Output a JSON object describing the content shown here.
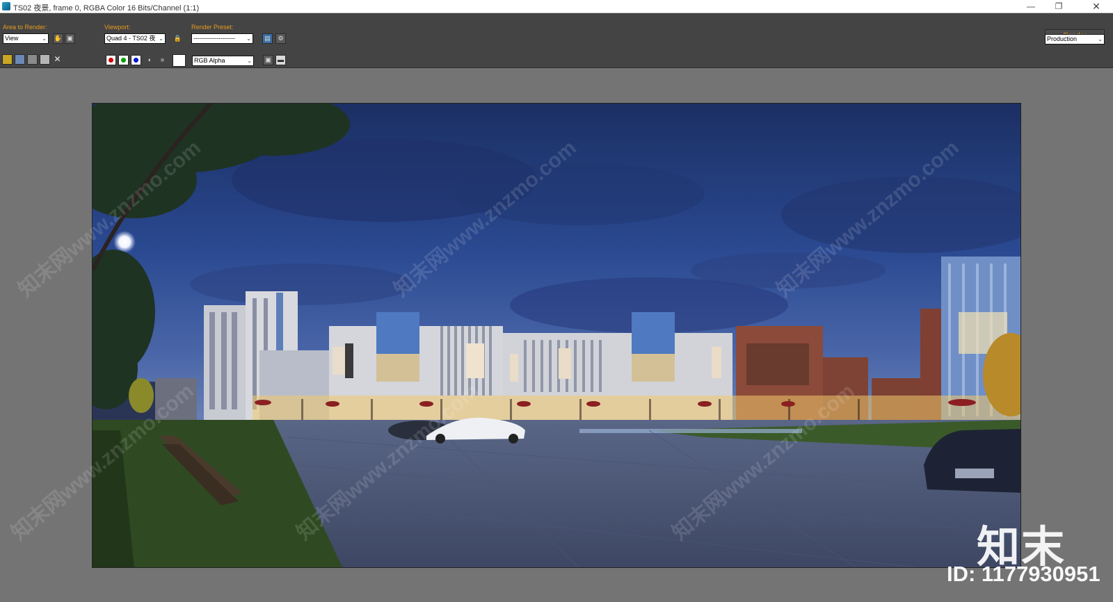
{
  "window": {
    "title": "TS02 夜景, frame 0, RGBA Color 16 Bits/Channel (1:1)",
    "minimize": "—",
    "restore": "❐",
    "close": "✕"
  },
  "toolbar": {
    "area_label": "Area to Render:",
    "area_value": "View",
    "viewport_label": "Viewport:",
    "viewport_value": "Quad 4 - TS02 夜",
    "preset_label": "Render Preset:",
    "preset_value": "--------------------",
    "render_button": "Render",
    "mode_value": "Production",
    "channel_value": "RGB Alpha"
  },
  "channels": {
    "red": "#d20000",
    "green": "#00a000",
    "blue": "#0018d0"
  },
  "icons": {
    "save": "save-icon",
    "copy": "copy-icon",
    "clone": "clone-icon",
    "print": "print-icon",
    "clear": "clear-icon",
    "lock": "lock-icon"
  },
  "watermark": {
    "text": "知末网www.znzmo.com",
    "logo": "知末",
    "id": "ID: 1177930951"
  }
}
